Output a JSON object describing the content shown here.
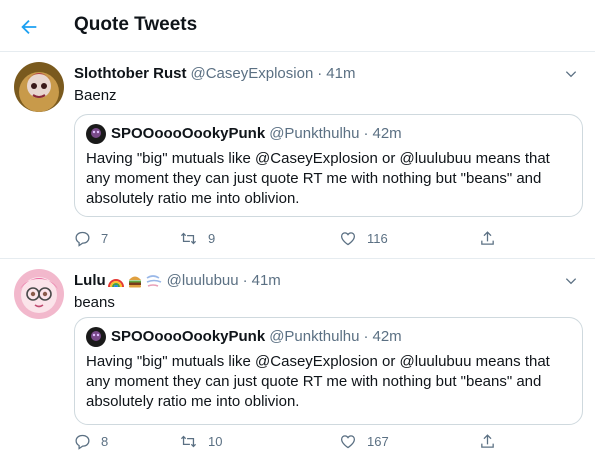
{
  "header": {
    "title": "Quote Tweets"
  },
  "tweets": [
    {
      "name": "Slothtober Rust",
      "handle": "@CaseyExplosion",
      "dot": "·",
      "time": "41m",
      "text": "Baenz",
      "quote": {
        "name": "SPOOoooOookyPunk",
        "handle": "@Punkthulhu",
        "dot": "·",
        "time": "42m",
        "text": "Having \"big\" mutuals like @CaseyExplosion or @luulubuu means that any moment they can just quote RT me with nothing but \"beans\" and absolutely ratio me into oblivion."
      },
      "replies": "7",
      "retweets": "9",
      "likes": "116"
    },
    {
      "name": "Lulu",
      "handle": "@luulubuu",
      "dot": "·",
      "time": "41m",
      "text": "beans",
      "quote": {
        "name": "SPOOoooOookyPunk",
        "handle": "@Punkthulhu",
        "dot": "·",
        "time": "42m",
        "text": "Having \"big\" mutuals like @CaseyExplosion or @luulubuu means that any moment they can just quote RT me with nothing but \"beans\" and absolutely ratio me into oblivion."
      },
      "replies": "8",
      "retweets": "10",
      "likes": "167"
    }
  ],
  "icons": {
    "back": "arrow-left-icon",
    "caret": "chevron-down-icon",
    "reply": "reply-icon",
    "retweet": "retweet-icon",
    "like": "heart-icon",
    "share": "share-icon"
  },
  "colors": {
    "accent": "#1da1f2",
    "secondary_text": "#5b7083",
    "border": "#e6ecf0"
  }
}
